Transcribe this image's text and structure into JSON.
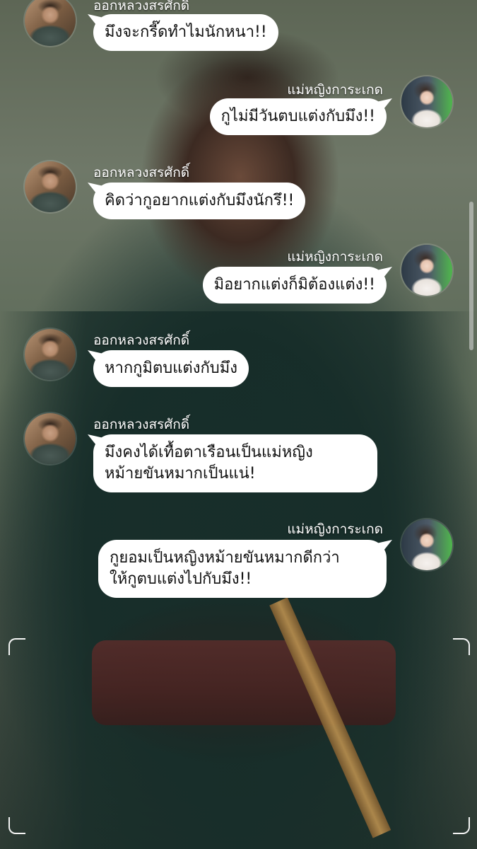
{
  "chat": {
    "messages": [
      {
        "sender": "ออกหลวงสรศักดิ์",
        "text": "มึงจะกรี๊ดทำไมนักหนา!!",
        "side": "left",
        "avatar": "man-avatar"
      },
      {
        "sender": "แม่หญิงการะเกด",
        "text": "กูไม่มีวันตบแต่งกับมึง!!",
        "side": "right",
        "avatar": "woman-avatar"
      },
      {
        "sender": "ออกหลวงสรศักดิ์",
        "text": "คิดว่ากูอยากแต่งกับมึงนักรึ!!",
        "side": "left",
        "avatar": "man-avatar"
      },
      {
        "sender": "แม่หญิงการะเกด",
        "text": "มิอยากแต่งก็มิต้องแต่ง!!",
        "side": "right",
        "avatar": "woman-avatar"
      },
      {
        "sender": "ออกหลวงสรศักดิ์",
        "text": "หากกูมิตบแต่งกับมึง",
        "side": "left",
        "avatar": "man-avatar"
      },
      {
        "sender": "ออกหลวงสรศักดิ์",
        "text": "มึงคงได้เทื้อตาเรือนเป็นแม่หญิง\nหม้ายขันหมากเป็นแน่!",
        "side": "left",
        "avatar": "man-avatar"
      },
      {
        "sender": "แม่หญิงการะเกด",
        "text": "กูยอมเป็นหญิงหม้ายขันหมากดีกว่า\nให้กูตบแต่งไปกับมึง!!",
        "side": "right",
        "avatar": "woman-avatar"
      }
    ]
  },
  "colors": {
    "bubble": "#ffffff",
    "bubble_text": "#111111",
    "sender_name": "#ffffff"
  }
}
